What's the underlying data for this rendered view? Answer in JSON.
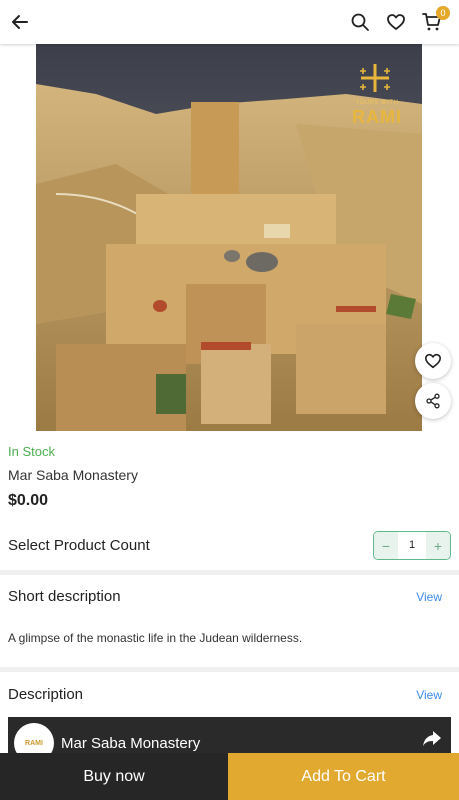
{
  "header": {
    "cart_count": "0",
    "icons": [
      "back-arrow-icon",
      "search-icon",
      "heart-icon",
      "cart-icon"
    ]
  },
  "hero": {
    "logo_small": "TOURS WITH",
    "logo_big": "RAMI"
  },
  "product": {
    "stock_status": "In Stock",
    "name": "Mar Saba Monastery",
    "price": "$0.00",
    "count_label": "Select Product Count",
    "quantity": "1",
    "minus": "−",
    "plus": "+"
  },
  "short_description": {
    "title": "Short description",
    "view": "View",
    "text": "A glimpse of the monastic life in the Judean wilderness."
  },
  "description": {
    "title": "Description",
    "view": "View",
    "video_title": "Mar Saba Monastery",
    "channel_logo": "RAMI"
  },
  "actions": {
    "buy_now": "Buy now",
    "add_to_cart": "Add To Cart"
  },
  "colors": {
    "in_stock": "#4caf50",
    "accent": "#e2a930",
    "dark": "#262626",
    "link": "#3d8be8"
  }
}
